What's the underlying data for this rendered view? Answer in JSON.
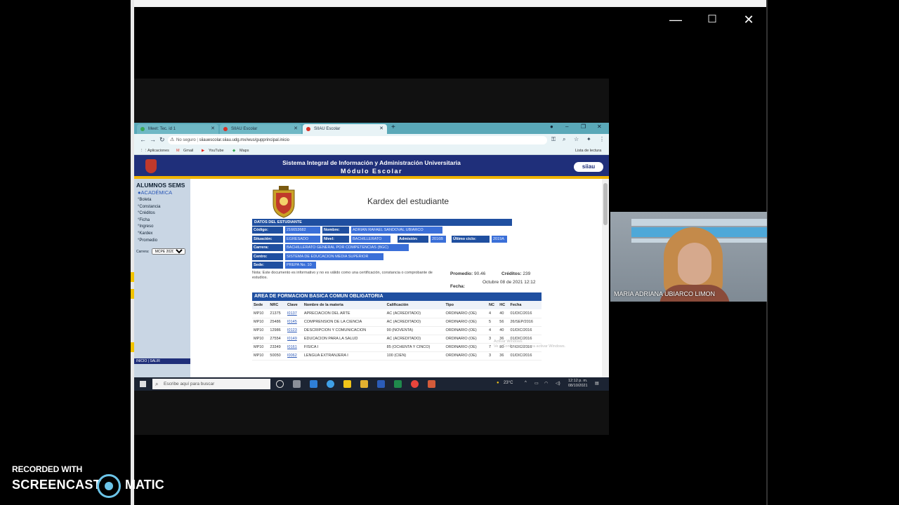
{
  "meeting_window": {
    "minimize_icon": "—",
    "maximize_icon": "☐",
    "close_icon": "✕"
  },
  "browser": {
    "tabs": [
      {
        "label": "Meet: Tec. id 1",
        "active": false,
        "favicon_color": "#3aa757"
      },
      {
        "label": "SIIAU Escolar",
        "active": false,
        "favicon_color": "#d93025"
      },
      {
        "label": "SIIAU Escolar",
        "active": true,
        "favicon_color": "#d93025"
      }
    ],
    "address": {
      "security": "No seguro",
      "url": "siiauescolar.siiau.udg.mx/wus/gupprincipal.inicio"
    },
    "bookmarks": [
      {
        "label": "Aplicaciones"
      },
      {
        "label": "Gmail"
      },
      {
        "label": "YouTube"
      },
      {
        "label": "Maps"
      }
    ],
    "reading_list": "Lista de lectura"
  },
  "siiau": {
    "header_line1": "Sistema Integral de Información y Administración Universitaria",
    "header_line2": "Módulo Escolar",
    "logo": "siiau"
  },
  "sidebar": {
    "title": "ALUMNOS SEMS",
    "section": "●ACADÉMICA",
    "items": [
      {
        "label": "°Boleta"
      },
      {
        "label": "°Constancia"
      },
      {
        "label": "°Créditos"
      },
      {
        "label": "°Ficha"
      },
      {
        "label": "°Ingreso"
      },
      {
        "label": "°Kardex"
      },
      {
        "label": "°Promedio"
      }
    ],
    "carrera_label": "Carrera:",
    "carrera_value": "MCPE 2020-A",
    "footer": "INICIO | SALIR"
  },
  "kardex": {
    "title": "Kardex del estudiante",
    "datos_header": "DATOS DEL ESTUDIANTE",
    "codigo_label": "Código:",
    "codigo_value": "216653682",
    "nombre_label": "Nombre:",
    "nombre_value": "ADRIAN RAFAEL SANDOVAL UBIARCO",
    "situacion_label": "Situación:",
    "situacion_value": "EGRESADO",
    "nivel_label": "Nivel:",
    "nivel_value": "BACHILLERATO",
    "admision_label": "Admisión:",
    "admision_value": "2016B",
    "ultimo_label": "Último ciclo:",
    "ultimo_value": "2019A",
    "carrera_label": "Carrera:",
    "carrera_value": "BACHILLERATO GENERAL POR COMPETENCIAS (BGC)",
    "centro_label": "Centro:",
    "centro_value": "SISTEMA DE EDUCACION MEDIA SUPERIOR",
    "sede_label": "Sede:",
    "sede_value": "PREPA No. 10",
    "nota": "Nota: Este documento es informativo y no es válido como una certificación, constancia o comprobante de estudios.",
    "promedio_label": "Promedio:",
    "promedio_value": "90.46",
    "creditos_label": "Créditos:",
    "creditos_value": "239",
    "fecha_label": "Fecha:",
    "fecha_value": "Octubre 08 de 2021 12:12"
  },
  "area": {
    "title": "AREA DE FORMACION BASICA COMUN OBLIGATORIA",
    "columns": [
      "Sede",
      "NRC",
      "Clave",
      "Nombre de la materia",
      "Calificación",
      "Tipo",
      "NC",
      "HC",
      "Fecha"
    ],
    "rows": [
      [
        "MP10",
        "21375",
        "I0137",
        "APRECIACION DEL ARTE",
        "AC (ACREDITADO)",
        "ORDINARIO (OE)",
        "4",
        "40",
        "01/DIC/2016"
      ],
      [
        "MP10",
        "25486",
        "I0145",
        "COMPRENSION DE LA CIENCIA",
        "AC (ACREDITADO)",
        "ORDINARIO (OE)",
        "5",
        "56",
        "26/SEP/2016"
      ],
      [
        "MP10",
        "12986",
        "I0123",
        "DESCRIPCION Y COMUNICACION",
        "90 (NOVENTA)",
        "ORDINARIO (OE)",
        "4",
        "40",
        "01/DIC/2016"
      ],
      [
        "MP10",
        "27554",
        "I0149",
        "EDUCACION PARA LA SALUD",
        "AC (ACREDITADO)",
        "ORDINARIO (OE)",
        "3",
        "36",
        "01/DIC/2016"
      ],
      [
        "MP10",
        "23349",
        "I0161",
        "FISICA I",
        "85 (OCHENTA Y CINCO)",
        "ORDINARIO (OE)",
        "7",
        "80",
        "07/DIC/2016"
      ],
      [
        "MP10",
        "50050",
        "I0062",
        "LENGUA EXTRANJERA I",
        "100 (CIEN)",
        "ORDINARIO (OE)",
        "3",
        "36",
        "01/DIC/2016"
      ]
    ]
  },
  "watermark_text": "Activar Windows\nVe a Configuración para activar Windows.",
  "taskbar": {
    "search_placeholder": "Escribe aquí para buscar",
    "weather": "23°C",
    "time": "12:12 p. m.",
    "date": "08/10/2021"
  },
  "webcam": {
    "participant_name": "MARIA ADRIANA UBIARCO LIMON"
  },
  "recorder": {
    "line1": "RECORDED WITH",
    "brand_left": "SCREENCAST",
    "brand_right": "MATIC"
  }
}
